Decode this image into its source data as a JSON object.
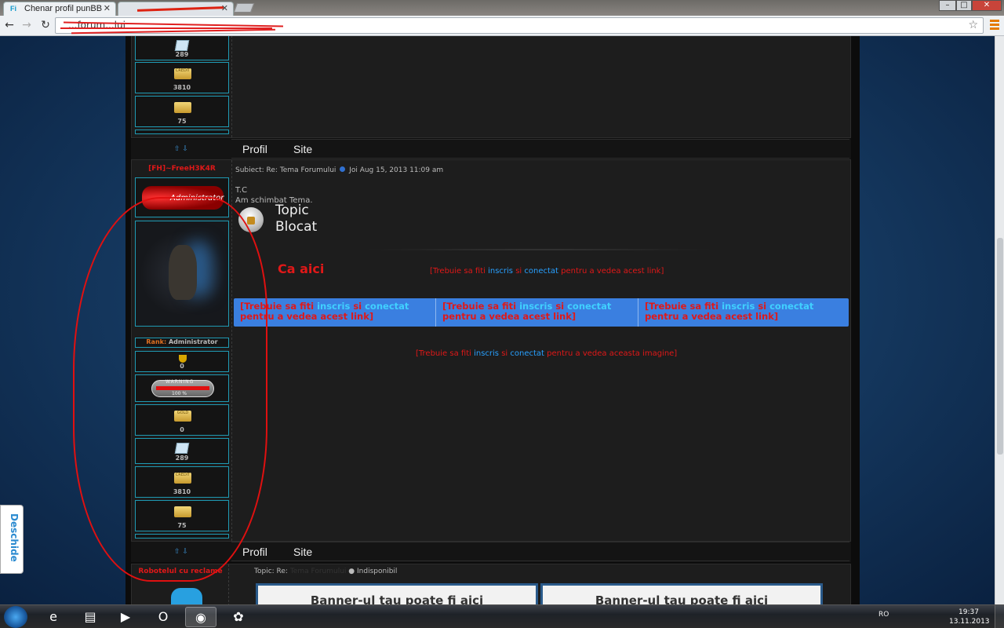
{
  "browser": {
    "tabs": [
      {
        "label": "Chenar profil punBB",
        "favicon": "Fi"
      },
      {
        "label": "",
        "favicon": ""
      }
    ],
    "url": "...forum...lui",
    "window_buttons": [
      "–",
      "□",
      "✕"
    ]
  },
  "sidebar_first": {
    "values": [
      "289",
      "3810",
      "75"
    ]
  },
  "post_bar": {
    "profil": "Profil",
    "site": "Site",
    "arrows": "⇧ ⇩"
  },
  "post": {
    "username": "[FH]~FreeH3K4R",
    "badge": "Administrator",
    "rank_label": "Rank:",
    "rank_value": "Administrator",
    "trophy_count": "0",
    "warning_text": "WARNING",
    "warning_pct": "100 %",
    "values": [
      "0",
      "289",
      "3810",
      "75"
    ],
    "subject_prefix": "Subiect: Re: Tema Forumului",
    "subject_date": "Joi Aug 15, 2013 11:09 am",
    "line1": "T.C",
    "line2": "Am schimbat Tema.",
    "topic_locked": [
      "Topic",
      "Blocat"
    ],
    "ca_aici": "Ca aici",
    "link_parts": [
      "[Trebuie sa fiti ",
      "inscris",
      " si ",
      "conectat",
      " pentru a vedea acest link]"
    ],
    "image_parts": [
      "[Trebuie sa fiti ",
      "inscris",
      " si ",
      "conectat",
      " pentru a vedea aceasta imagine]"
    ],
    "blue_cells": [
      [
        "[Trebuie sa fiti ",
        "inscris",
        " si ",
        "conectat",
        " pentru a vedea acest link]"
      ],
      [
        "[Trebuie sa fiti ",
        "inscris",
        " si ",
        "conectat",
        " pentru a vedea acest link]"
      ],
      [
        "[Trebuie sa fiti ",
        "inscris",
        " si ",
        "conectat",
        " pentru a vedea acest link]"
      ]
    ]
  },
  "robot": {
    "title": "Robotelul cu reclame",
    "topic_prefix": "Topic: Re:",
    "topic_hidden": "Tema Forumului",
    "status": "Indisponibil",
    "banner": "Banner-ul tau poate fi aici"
  },
  "widget": {
    "deschide": "Deschide"
  },
  "taskbar": {
    "lang": "RO",
    "time": "19:37",
    "date": "13.11.2013"
  },
  "colors": {
    "accent": "#1f9ab3",
    "red": "#e01818",
    "blue": "#28a0ff",
    "panel": "#1d1d1d"
  }
}
